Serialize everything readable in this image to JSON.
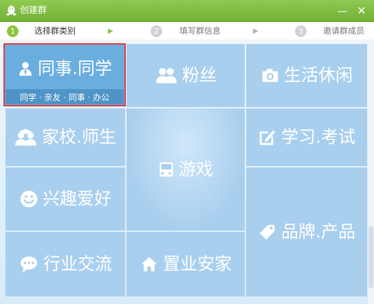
{
  "window": {
    "title": "创建群",
    "minimize_glyph": "—",
    "close_glyph": "✕"
  },
  "steps": [
    {
      "number": "1",
      "label": "选择群类别",
      "state": "active"
    },
    {
      "number": "2",
      "label": "填写群信息",
      "state": "inactive"
    },
    {
      "number": "3",
      "label": "邀请群成员",
      "state": "inactive"
    }
  ],
  "categories": {
    "colleague_classmate": {
      "label": "同事.同学",
      "subtitle": "同学 · 亲友 · 同事 · 办公",
      "icon": "person-icon"
    },
    "fans": {
      "label": "粉丝",
      "icon": "people-icon"
    },
    "life_leisure": {
      "label": "生活休闲",
      "icon": "camera-icon"
    },
    "school_teacher": {
      "label": "家校.师生",
      "icon": "graduates-icon"
    },
    "game": {
      "label": "游戏",
      "icon": "gamepad-icon"
    },
    "study_exam": {
      "label": "学习.考试",
      "icon": "edit-icon"
    },
    "hobby": {
      "label": "兴趣爱好",
      "icon": "smiley-icon"
    },
    "brand_product": {
      "label": "品牌.产品",
      "icon": "tag-icon"
    },
    "industry": {
      "label": "行业交流",
      "icon": "chat-icon"
    },
    "real_estate": {
      "label": "置业安家",
      "icon": "home-icon"
    }
  },
  "colors": {
    "titlebar": "#7cbb3f",
    "step_active": "#8cc63f",
    "tile": "#a9cfee",
    "tile_selected": "#6aaedf",
    "selection_border": "#e8373b"
  }
}
